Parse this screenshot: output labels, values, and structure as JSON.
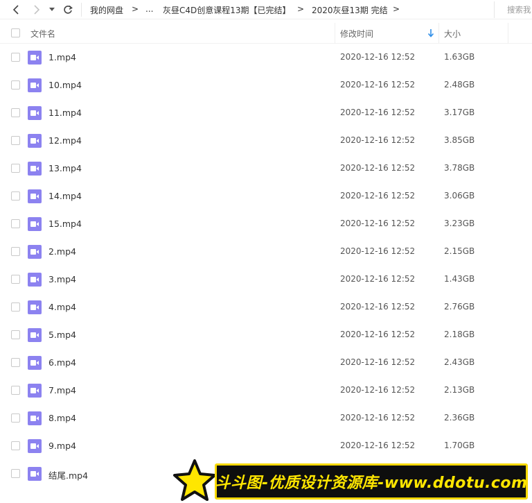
{
  "nav": {
    "breadcrumbs": [
      "我的网盘",
      "...",
      "灰昼C4D创意课程13期【已完结】",
      "2020灰昼13期 完结"
    ],
    "separator": ">",
    "search_placeholder": "搜索我"
  },
  "columns": {
    "name": "文件名",
    "modified": "修改时间",
    "size": "大小",
    "sort": "descending"
  },
  "file_icon": "video-file-icon",
  "accent_color": "#8c82f0",
  "files": [
    {
      "name": "1.mp4",
      "modified": "2020-12-16 12:52",
      "size": "1.63GB"
    },
    {
      "name": "10.mp4",
      "modified": "2020-12-16 12:52",
      "size": "2.48GB"
    },
    {
      "name": "11.mp4",
      "modified": "2020-12-16 12:52",
      "size": "3.17GB"
    },
    {
      "name": "12.mp4",
      "modified": "2020-12-16 12:52",
      "size": "3.85GB"
    },
    {
      "name": "13.mp4",
      "modified": "2020-12-16 12:52",
      "size": "3.78GB"
    },
    {
      "name": "14.mp4",
      "modified": "2020-12-16 12:52",
      "size": "3.06GB"
    },
    {
      "name": "15.mp4",
      "modified": "2020-12-16 12:52",
      "size": "3.23GB"
    },
    {
      "name": "2.mp4",
      "modified": "2020-12-16 12:52",
      "size": "2.15GB"
    },
    {
      "name": "3.mp4",
      "modified": "2020-12-16 12:52",
      "size": "1.43GB"
    },
    {
      "name": "4.mp4",
      "modified": "2020-12-16 12:52",
      "size": "2.76GB"
    },
    {
      "name": "5.mp4",
      "modified": "2020-12-16 12:52",
      "size": "2.18GB"
    },
    {
      "name": "6.mp4",
      "modified": "2020-12-16 12:52",
      "size": "2.43GB"
    },
    {
      "name": "7.mp4",
      "modified": "2020-12-16 12:52",
      "size": "2.13GB"
    },
    {
      "name": "8.mp4",
      "modified": "2020-12-16 12:52",
      "size": "2.36GB"
    },
    {
      "name": "9.mp4",
      "modified": "2020-12-16 12:52",
      "size": "1.70GB"
    },
    {
      "name": "结尾.mp4",
      "modified": "",
      "size": ""
    }
  ],
  "watermark": {
    "text": "斗斗图-优质设计资源库-www.ddotu.com"
  }
}
